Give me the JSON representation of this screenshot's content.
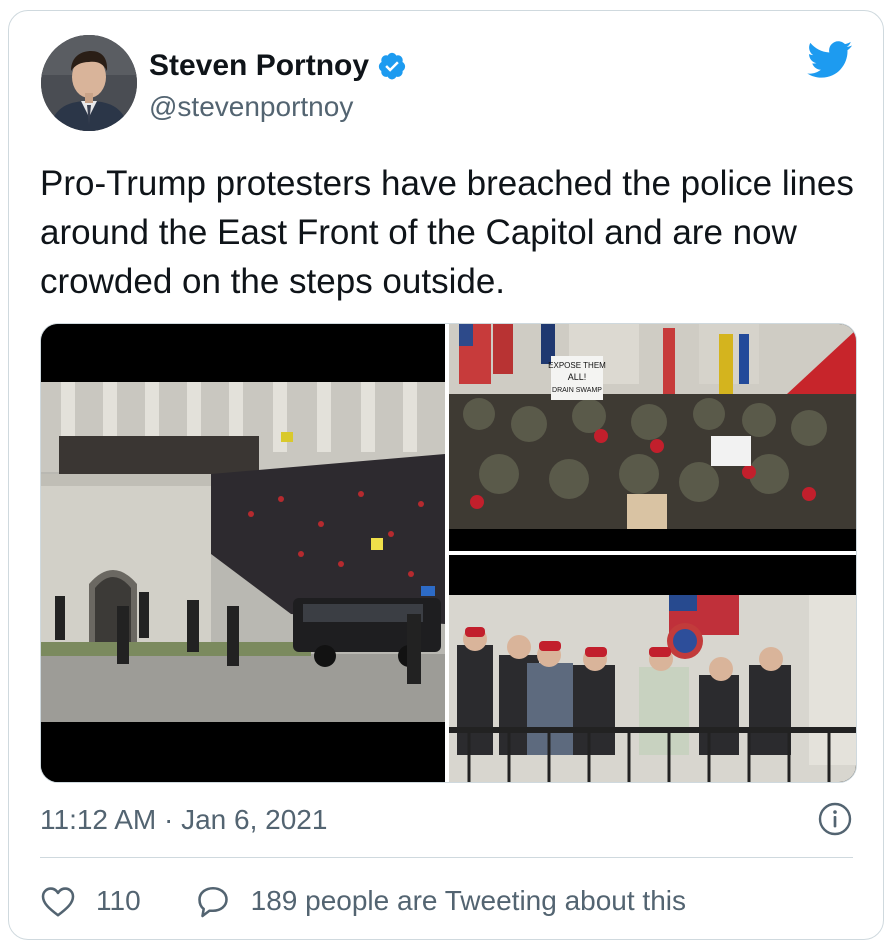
{
  "author": {
    "display_name": "Steven Portnoy",
    "handle": "@stevenportnoy",
    "verified": true
  },
  "tweet": {
    "text": "Pro-Trump protesters have breached the police lines around the East Front of the Capitol and are now crowded on the steps outside.",
    "timestamp": "11:12 AM · Jan 6, 2021"
  },
  "media": {
    "photo_1": {
      "sign_text": ""
    },
    "photo_2": {
      "sign_text": "EXPOSE THEM ALL! DRAIN THE SWAMP"
    },
    "photo_3": {
      "sign_text": ""
    }
  },
  "engagement": {
    "likes": "110",
    "tweeting_about": "189 people are Tweeting about this"
  },
  "icons": {
    "brand": "twitter-bird-icon",
    "verified": "verified-badge-icon",
    "info": "info-icon",
    "like": "heart-icon",
    "reply": "speech-bubble-icon"
  },
  "colors": {
    "brand_blue": "#1d9bf0",
    "text_primary": "#0f1419",
    "text_secondary": "#536471",
    "border": "#cfd9de"
  }
}
